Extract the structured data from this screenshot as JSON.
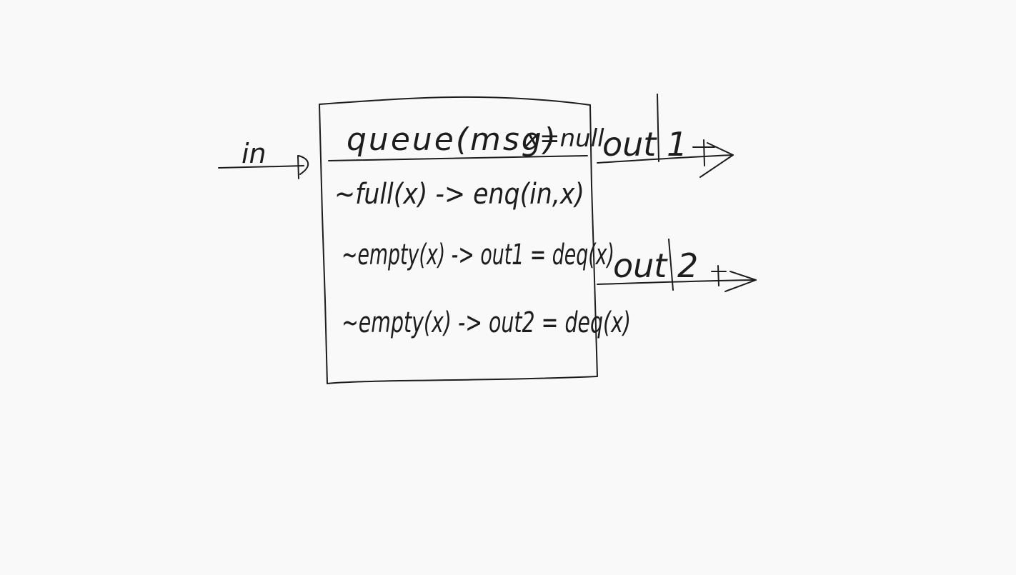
{
  "diagram": {
    "input_label": "in",
    "header": {
      "queue_label": "queue(msg)",
      "init_label": "x=null"
    },
    "rules": [
      {
        "text": "~full(x) -> enq(in,x)"
      },
      {
        "text": "~empty(x) -> out1 = deq(x)"
      },
      {
        "text": "~empty(x) -> out2 = deq(x)"
      }
    ],
    "outputs": [
      {
        "label": "out 1"
      },
      {
        "label": "out 2"
      }
    ],
    "ink_color": "#1d1d1d",
    "background_color": "#f9f9f9"
  }
}
